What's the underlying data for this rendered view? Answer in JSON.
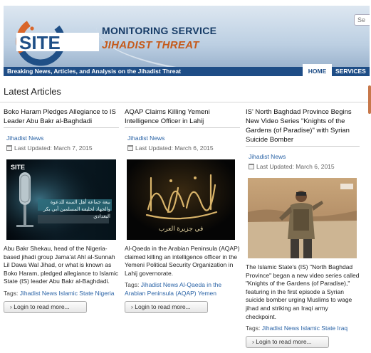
{
  "header": {
    "brand_line1": "MONITORING SERVICE",
    "brand_line2": "JIHADIST THREAT",
    "logo_text": "SITE",
    "search_placeholder": "Se",
    "tagline": "Breaking News, Articles, and Analysis on the Jihadist Threat",
    "nav": {
      "home": "HOME",
      "services": "SERVICES"
    }
  },
  "section_title": "Latest Articles",
  "articles": [
    {
      "title": "Boko Haram Pledges Allegiance to IS Leader Abu Bakr al-Baghdadi",
      "category": "Jihadist News",
      "updated": "Last Updated: March 7, 2015",
      "thumb_caption": "بيعة جماعة أهل السنة للدعوة والجهاد لخليفة المسلمين أبي بكر البغدادي",
      "thumb_logo": "SITE",
      "body": "Abu Bakr Shekau, head of the Nigeria-based jihadi group Jama'at Ahl al-Sunnah Lil Dawa Wal Jihad, or what is known as Boko Haram, pledged allegiance to Islamic State (IS) leader Abu Bakr al-Baghdadi.",
      "tags_label": "Tags:",
      "tags": "Jihadist News Islamic State Nigeria",
      "login": "Login to read more..."
    },
    {
      "title": "AQAP Claims Killing Yemeni Intelligence Officer in Lahij",
      "category": "Jihadist News",
      "updated": "Last Updated: March 6, 2015",
      "thumb_caption": "في جزيرة العرب",
      "body": "Al-Qaeda in the Arabian Peninsula (AQAP) claimed killing an intelligence officer in the Yemeni Political Security Organization in Lahij governorate.",
      "tags_label": "Tags:",
      "tags": "Jihadist News Al-Qaeda in the Arabian Peninsula (AQAP) Yemen",
      "login": "Login to read more..."
    },
    {
      "title": "IS' North Baghdad Province Begins New Video Series \"Knights of the Gardens (of Paradise)\" with Syrian Suicide Bomber",
      "category": "Jihadist News",
      "updated": "Last Updated: March 6, 2015",
      "body": "The Islamic State's (IS) \"North Baghdad Province\" began a new video series called \"Knights of the Gardens (of Paradise),\" featuring in the first episode a Syrian suicide bomber urging Muslims to wage jihad and striking an Iraqi army checkpoint.",
      "tags_label": "Tags:",
      "tags": "Jihadist News Islamic State Iraq",
      "login": "Login to read more..."
    }
  ],
  "colors": {
    "nav_bar": "#1e4d86",
    "brand_blue": "#163b66",
    "brand_orange": "#c55a1a",
    "link": "#2a63a6"
  }
}
